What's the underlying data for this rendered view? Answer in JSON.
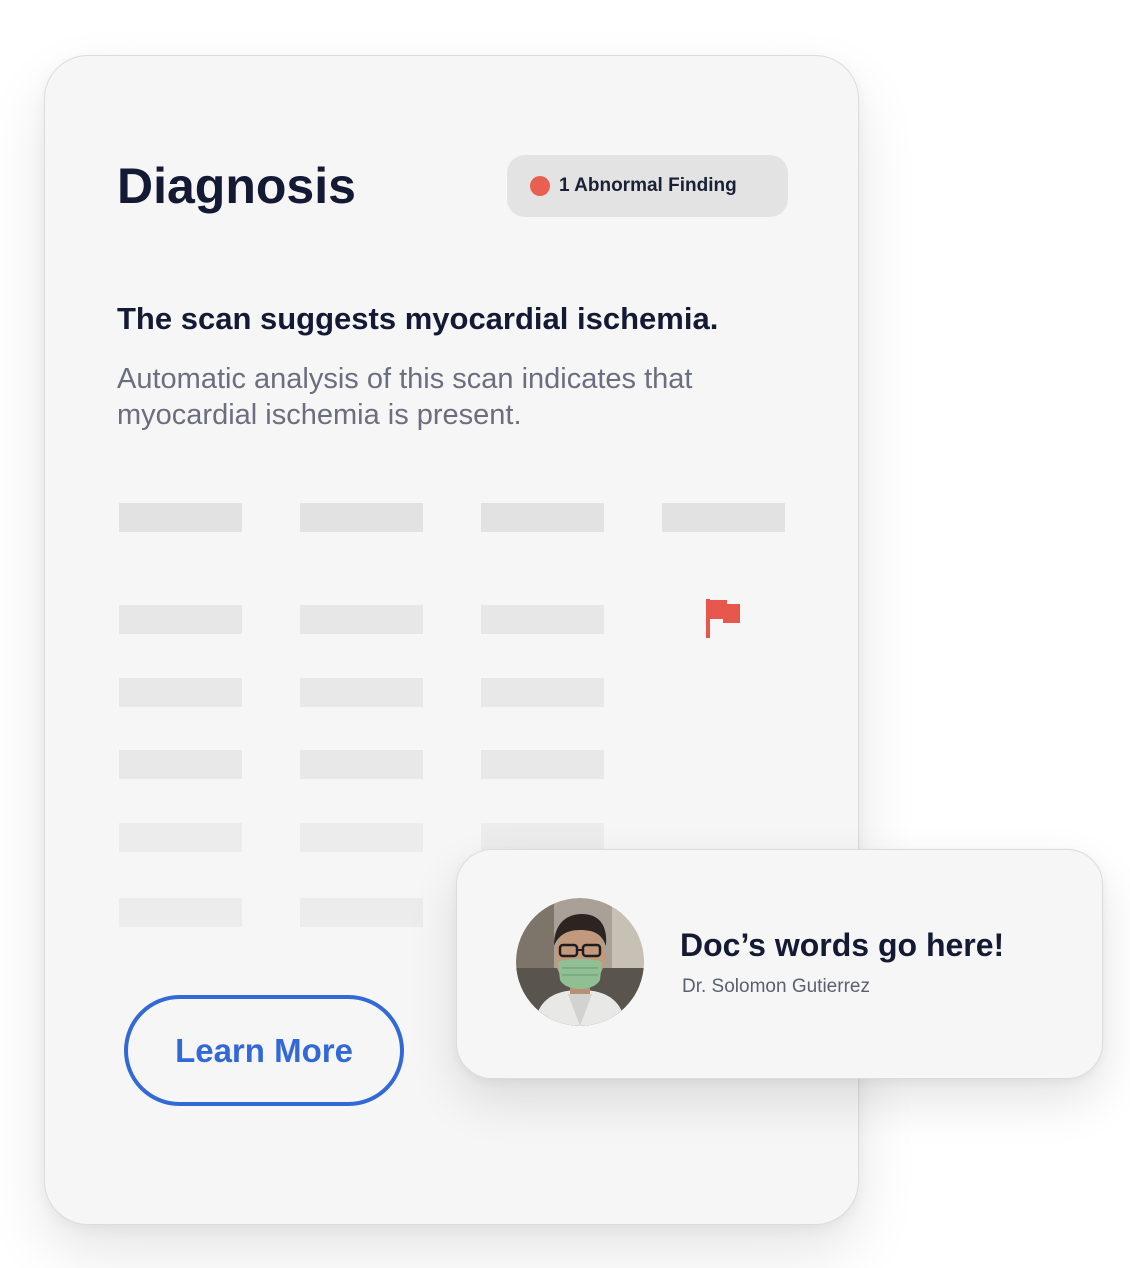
{
  "diagnosis_card": {
    "title": "Diagnosis",
    "badge": {
      "label": "1 Abnormal Finding",
      "dot_color": "#e95f52"
    },
    "headline": "The scan suggests myocardial ischemia.",
    "description": "Automatic analysis of this scan indicates that myocardial ischemia is present.",
    "results_table": {
      "columns": 4,
      "rows": 5,
      "flagged_row": 1,
      "flag_icon": "flag-icon",
      "flag_color": "#e8574b"
    },
    "learn_more_label": "Learn More",
    "accent_color": "#3369d6"
  },
  "doctor_quote": {
    "quote": "Doc’s words go here!",
    "doctor_name": "Dr. Solomon Gutierrez",
    "avatar_icon": "doctor-avatar"
  }
}
